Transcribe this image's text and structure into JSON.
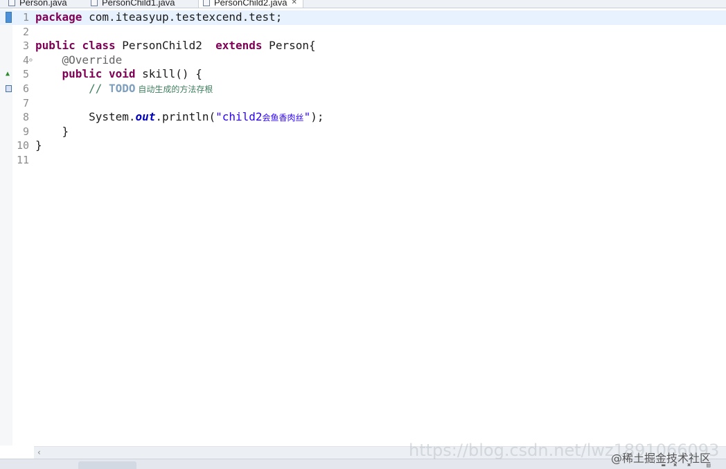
{
  "tabs": [
    {
      "label": "Person.java"
    },
    {
      "label": "PersonChild1.java"
    },
    {
      "label": "PersonChild2.java",
      "close": "✕"
    }
  ],
  "editor": {
    "line_numbers": [
      "1",
      "2",
      "3",
      "4",
      "5",
      "6",
      "7",
      "8",
      "9",
      "10",
      "11"
    ],
    "fold_marker": "⊖",
    "line1": {
      "kw": "package",
      "rest": " com.iteasyup.testexcend.test;"
    },
    "line3": {
      "kw1": "public",
      "kw2": "class",
      "name": " PersonChild2  ",
      "kw3": "extends",
      "rest": " Person{"
    },
    "line4": {
      "indent": "    ",
      "annotation": "@Override"
    },
    "line5": {
      "indent": "    ",
      "kw1": "public",
      "kw2": "void",
      "rest": " skill() {"
    },
    "line6": {
      "indent": "        ",
      "comment": "// ",
      "todo": "TODO",
      "cjk": " 自动生成的方法存根"
    },
    "line8": {
      "indent": "        ",
      "pre": "System.",
      "field": "out",
      "mid": ".println(",
      "str1": "\"child2",
      "str_cjk": "会鱼香肉丝",
      "str2": "\"",
      "end": ");"
    },
    "line9": {
      "indent": "    ",
      "brace": "}"
    },
    "line10": {
      "brace": "}"
    }
  },
  "scrollbar": {
    "left_arrow": "‹"
  },
  "watermark": {
    "url": "https://blog.csdn.net/lwz1891066093",
    "community": "@稀土掘金技术社区"
  },
  "colors": {
    "keyword": "#7f0055",
    "string": "#2a00ff",
    "comment": "#3f7f5f",
    "todo": "#7f9fbf",
    "field": "#0000c0",
    "current_line": "#e8f2fe"
  }
}
